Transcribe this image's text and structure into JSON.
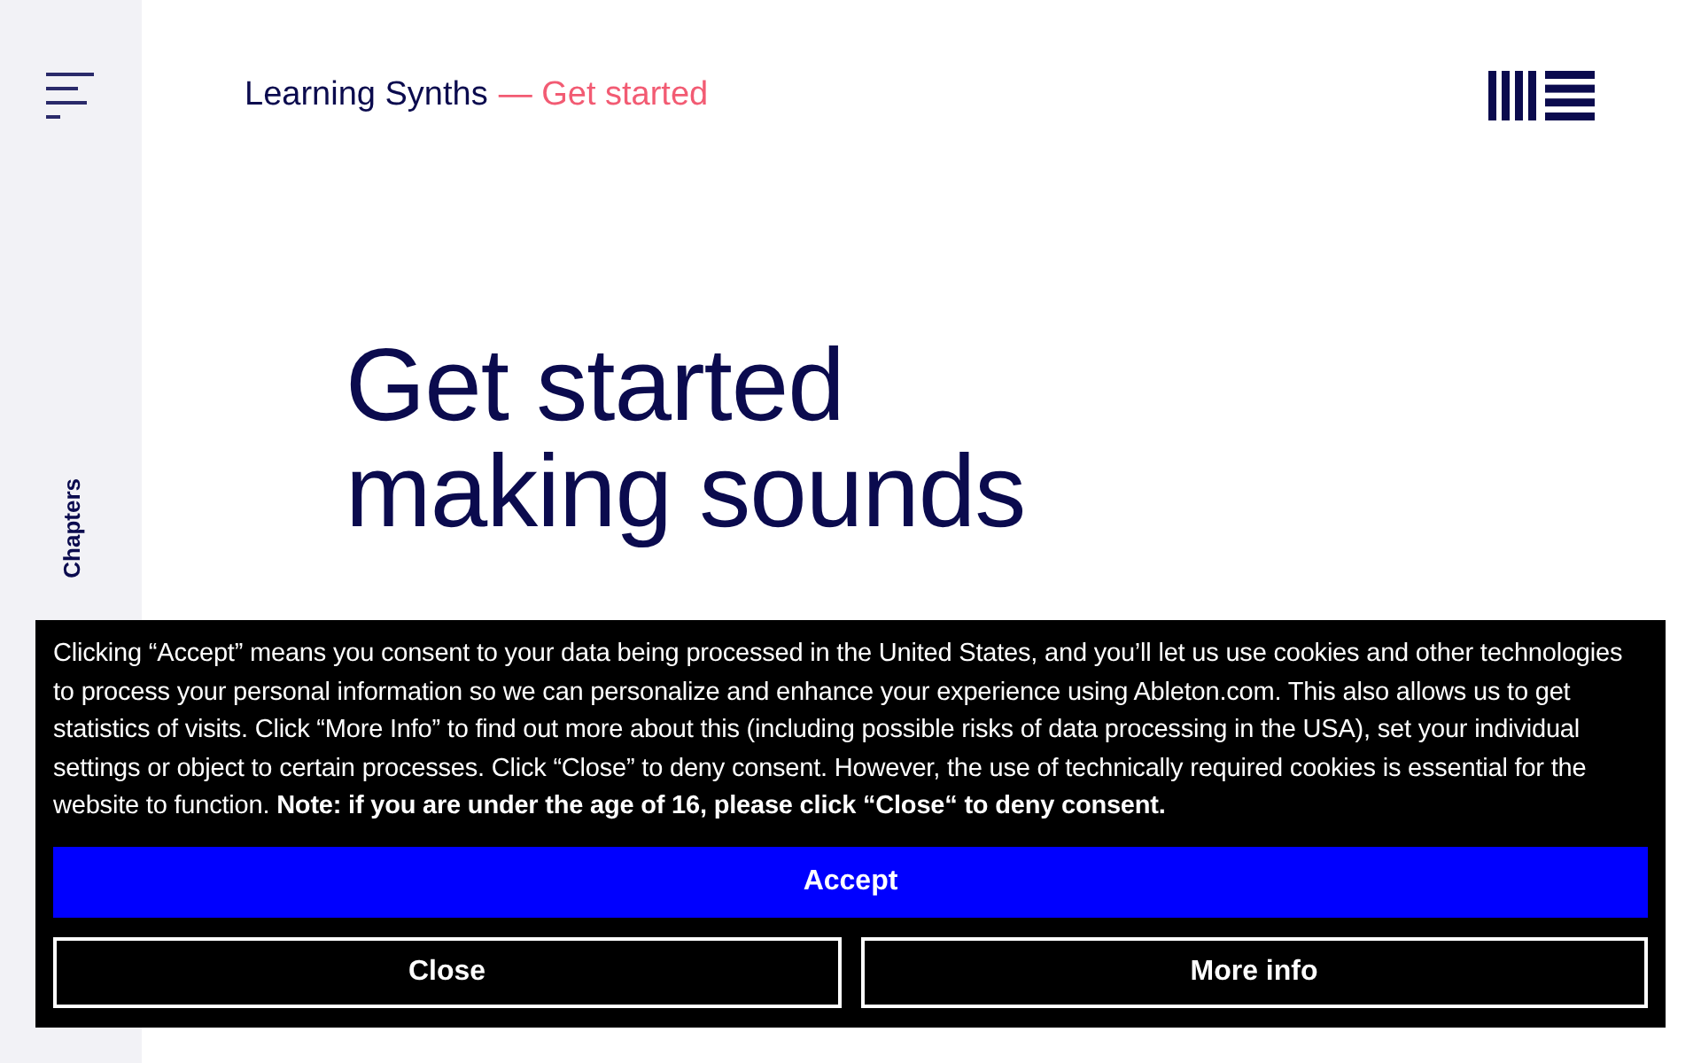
{
  "sidebar": {
    "label": "Chapters"
  },
  "header": {
    "breadcrumb": "Learning Synths",
    "current": "— Get started"
  },
  "hero": {
    "title_lines": [
      "Get started",
      "making sounds"
    ]
  },
  "cookie_banner": {
    "text": "Clicking “Accept” means you consent to your data being processed in the United States, and you’ll let us use cookies and other technologies to process your personal information so we can personalize and enhance your experience using Ableton.com. This also allows us to get statistics of visits. Click “More Info” to find out more about this (including possible risks of data processing in the USA), set your individual settings or object to certain processes. Click “Close” to deny consent. However, the use of technically required cookies is essential for the website to function. **Note: if you are under the age of 16, please click “Close“ to deny consent.**",
    "buttons": [
      {
        "label": "Accept",
        "kind": "primary"
      },
      {
        "label": "Close",
        "kind": "secondary"
      },
      {
        "label": "More info",
        "kind": "secondary"
      }
    ]
  }
}
